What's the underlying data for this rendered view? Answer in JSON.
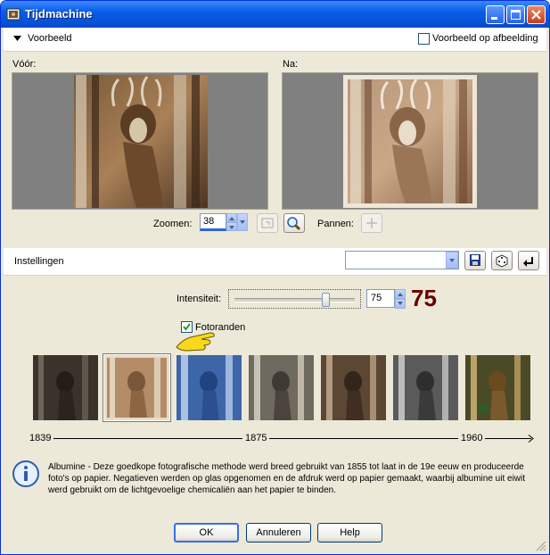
{
  "window": {
    "title": "Tijdmachine"
  },
  "preview_section": {
    "label": "Voorbeeld",
    "checkbox_label": "Voorbeeld op afbeelding",
    "before_label": "Vóór:",
    "after_label": "Na:",
    "zoom_label": "Zoomen:",
    "zoom_value": "38",
    "pan_label": "Pannen:"
  },
  "settings": {
    "label": "Instellingen",
    "preset_value": "",
    "intensity_label": "Intensiteit:",
    "intensity_value": "75",
    "intensity_big": "75",
    "intensity_level": 0.75,
    "photo_borders_label": "Fotoranden",
    "photo_borders_checked": true
  },
  "timeline": {
    "start": "1839",
    "middle": "1875",
    "end": "1960"
  },
  "thumbnails": [
    {
      "name": "thumb-1",
      "tone": "dark",
      "selected": false
    },
    {
      "name": "thumb-2",
      "tone": "albumine",
      "selected": true
    },
    {
      "name": "thumb-3",
      "tone": "cyanotype",
      "selected": false
    },
    {
      "name": "thumb-4",
      "tone": "platinum",
      "selected": false
    },
    {
      "name": "thumb-5",
      "tone": "sepia-dark",
      "selected": false
    },
    {
      "name": "thumb-6",
      "tone": "grey",
      "selected": false
    },
    {
      "name": "thumb-7",
      "tone": "color",
      "selected": false
    }
  ],
  "info_text": "Albumine - Deze goedkope fotografische methode werd breed gebruikt van 1855 tot laat in de 19e eeuw en produceerde foto's op papier. Negatieven werden op glas opgenomen en de afdruk werd op papier gemaakt, waarbij albumine uit eiwit werd gebruikt om de lichtgevoelige chemicaliën aan het papier te binden.",
  "buttons": {
    "ok": "OK",
    "cancel": "Annuleren",
    "help": "Help"
  },
  "colors": {
    "titlebar": "#0a5ee8",
    "intensity_big": "#6b0000"
  }
}
